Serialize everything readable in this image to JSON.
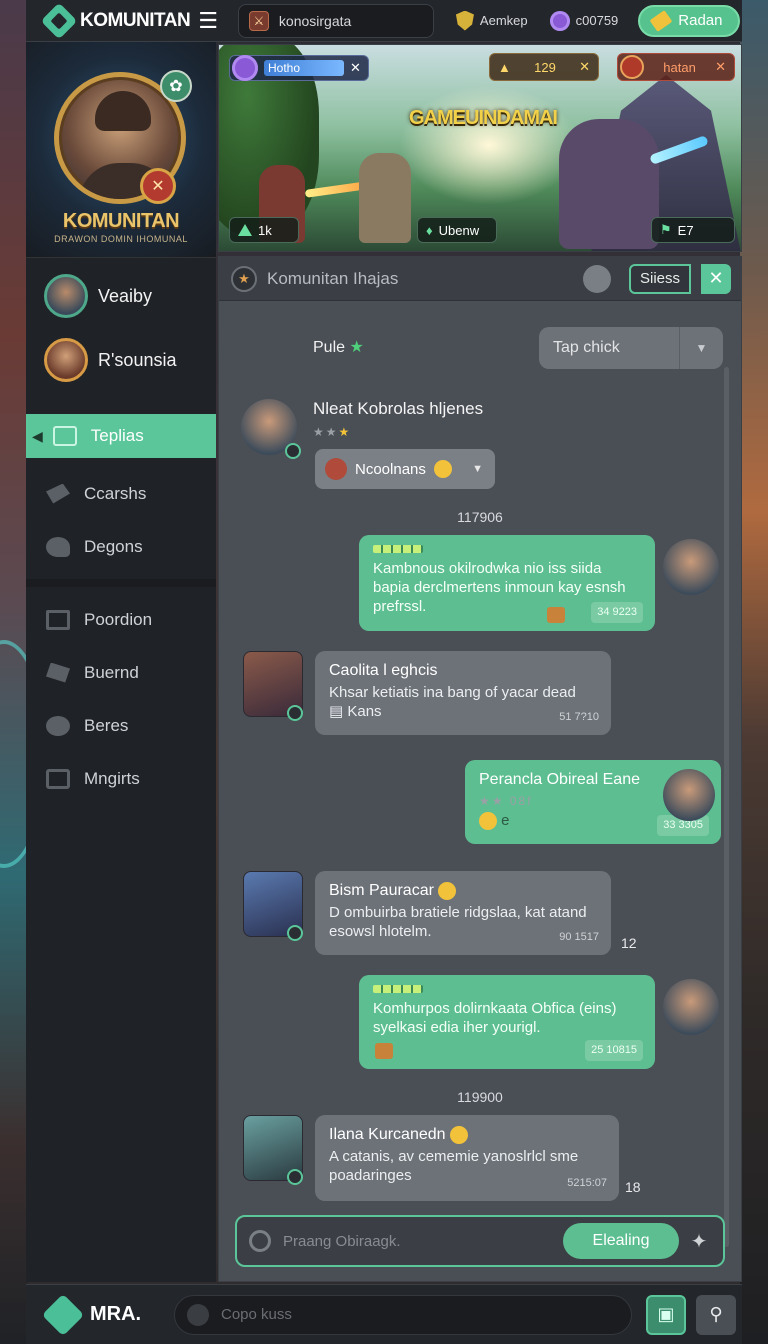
{
  "topbar": {
    "logo_text": "KOMUNITAN",
    "menu_icon": "hamburger-icon",
    "search_text": "konosirgata",
    "stat1": "Aemkep",
    "stat2": "c00759",
    "redeem_label": "Radan"
  },
  "profile": {
    "title": "KOMUNITAN",
    "subtitle": "DRAWON DOMIN IHOMUNAL"
  },
  "friends": [
    {
      "name": "Veaiby"
    },
    {
      "name": "R'sounsia"
    }
  ],
  "menu": {
    "group1": [
      {
        "label": "Teplias",
        "icon": "template-icon",
        "active": true
      },
      {
        "label": "Ccarshs",
        "icon": "cards-icon"
      },
      {
        "label": "Degons",
        "icon": "dragon-icon"
      }
    ],
    "group2": [
      {
        "label": "Poordion",
        "icon": "news-icon"
      },
      {
        "label": "Buernd",
        "icon": "calendar-icon"
      },
      {
        "label": "Beres",
        "icon": "bars-icon"
      },
      {
        "label": "Mngirts",
        "icon": "edit-icon"
      }
    ]
  },
  "banner": {
    "level_label": "Hotho",
    "coins": "129",
    "hatan": "hatan",
    "title": "GAMEUINDAMAI",
    "bottom_left": "1k",
    "bottom_center": "Ubenw",
    "bottom_right": "E7"
  },
  "chat": {
    "header_title": "Komunitan Ihajas",
    "filter_label": "Siiess",
    "pule_label": "Pule",
    "tap_check": "Tap chick",
    "messages": [
      {
        "who": "Nleat Kobrolas hljenes",
        "reply_chip": "Ncoolnans"
      },
      {
        "day": "117906"
      },
      {
        "text": "Kambnous okilrodwka nio iss siida bapia derclmertens inmoun kay esnsh prefrssl.",
        "time": "34 9223"
      },
      {
        "who": "Caolita l eghcis",
        "text": "Khsar ketiatis ina bang of yacar dead",
        "sub": "Kans",
        "time": "51 7?10"
      },
      {
        "who": "Perancla Obireal Eane",
        "extra": "08f",
        "time": "33 3305"
      },
      {
        "who": "Bism Pauracar",
        "text": "D ombuirba bratiele ridgslaa, kat atand esowsl hlotelm.",
        "time": "90 1517",
        "count": "12"
      },
      {
        "text": "Komhurpos dolirnkaata Obfica (eins) syelkasi edia iher yourigl.",
        "time": "25 10815"
      },
      {
        "day": "119900"
      },
      {
        "who": "Ilana Kurcanedn",
        "text": "A catanis, av cememie yanoslrlcl sme poadaringes",
        "time": "5215:07",
        "count": "18"
      }
    ],
    "composer_placeholder": "Praang Obiraagk.",
    "send_label": "Elealing"
  },
  "bottombar": {
    "logo_text": "MRA.",
    "search_placeholder": "Copo kuss"
  }
}
